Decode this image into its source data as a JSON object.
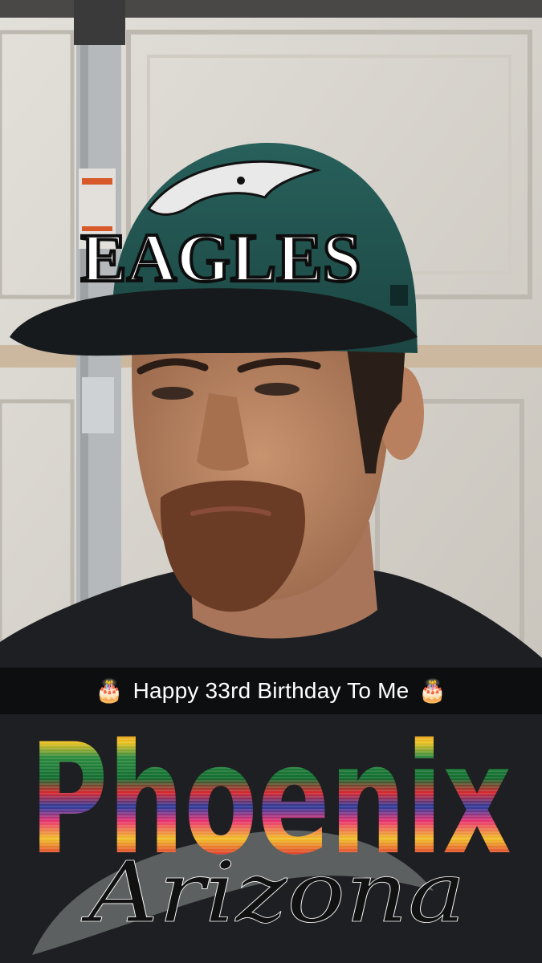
{
  "caption": {
    "text": "Happy 33rd Birthday To Me",
    "leading_emoji": "🎂",
    "trailing_emoji": "🎂",
    "leading_emoji_icon": "birthday-cake-icon",
    "trailing_emoji_icon": "birthday-cake-icon"
  },
  "cap": {
    "logo_text": "EAGLES"
  },
  "geofilter": {
    "city": "Phoenix",
    "state": "Arizona"
  },
  "colors": {
    "cap_green": "#1d4a47",
    "cap_brim": "#171a1c",
    "shirt": "#1e1f22",
    "garage_door": "#dcd9d3",
    "skin": "#b88464",
    "beard": "#6b3c25"
  }
}
